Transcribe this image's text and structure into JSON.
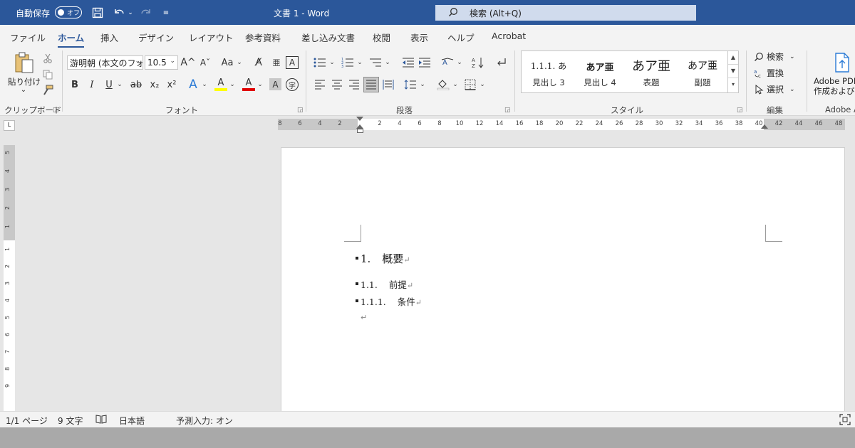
{
  "titlebar": {
    "autosave_label": "自動保存",
    "autosave_state": "オフ",
    "doc_title": "文書 1  -  Word",
    "search_placeholder": "検索 (Alt+Q)",
    "icons": [
      "save-icon",
      "undo-icon",
      "redo-icon",
      "customize-icon",
      "search-icon"
    ]
  },
  "tabs": [
    {
      "label": "ファイル",
      "active": false
    },
    {
      "label": "ホーム",
      "active": true
    },
    {
      "label": "挿入",
      "active": false
    },
    {
      "label": "デザイン",
      "active": false
    },
    {
      "label": "レイアウト",
      "active": false
    },
    {
      "label": "参考資料",
      "active": false
    },
    {
      "label": "差し込み文書",
      "active": false
    },
    {
      "label": "校閲",
      "active": false
    },
    {
      "label": "表示",
      "active": false
    },
    {
      "label": "ヘルプ",
      "active": false
    },
    {
      "label": "Acrobat",
      "active": false
    }
  ],
  "ribbon": {
    "clipboard": {
      "paste_label": "貼り付け",
      "paste_arrow": "⌄",
      "group_label": "クリップボード"
    },
    "font": {
      "font_name": "游明朝 (本文のフォ",
      "font_size": "10.5",
      "group_label": "フォント",
      "bold": "B",
      "italic": "I",
      "underline": "U",
      "strike": "ab",
      "sub": "x₂",
      "sup": "x²",
      "change_case": "Aa",
      "highlight_letter": "A",
      "color_letter": "A",
      "shade_letter": "A",
      "grow": "A^",
      "shrink": "Aˇ",
      "effects_letter": "A",
      "ruby": "亜",
      "border_letter": "A",
      "enclose": "字"
    },
    "paragraph": {
      "group_label": "段落"
    },
    "styles": {
      "group_label": "スタイル",
      "items": [
        {
          "sample": "1.1.1. あ",
          "name": "見出し 3"
        },
        {
          "sample": "あア亜",
          "name": "見出し 4"
        },
        {
          "sample": "あア亜",
          "name": "表題"
        },
        {
          "sample": "あア亜",
          "name": "副題"
        }
      ]
    },
    "editing": {
      "group_label": "編集",
      "find": "検索",
      "replace": "置換",
      "select": "選択"
    },
    "adobe": {
      "line1": "Adobe PDF",
      "line2": "作成および",
      "group_label": "Adobe A"
    }
  },
  "ruler": {
    "h_labels": [
      "8",
      "6",
      "4",
      "2",
      "2",
      "4",
      "6",
      "8",
      "10",
      "12",
      "14",
      "16",
      "18",
      "20",
      "22",
      "24",
      "26",
      "28",
      "30",
      "32",
      "34",
      "36",
      "38",
      "40",
      "42",
      "44",
      "46",
      "48"
    ],
    "v_labels": [
      "5",
      "4",
      "3",
      "2",
      "1",
      "1",
      "2",
      "3",
      "4",
      "5",
      "6",
      "7",
      "8",
      "9"
    ]
  },
  "document": {
    "lines": [
      {
        "number": "1.",
        "text": "概要"
      },
      {
        "number": "1.1.",
        "text": "前提"
      },
      {
        "number": "1.1.1.",
        "text": "条件"
      }
    ],
    "paragraph_mark": "↵"
  },
  "statusbar": {
    "page": "1/1 ページ",
    "words": "9 文字",
    "language": "日本語",
    "predictive": "予測入力: オン"
  },
  "colors": {
    "brand": "#2b579a",
    "ribbon_bg": "#f3f3f3",
    "highlight": "#ffff00",
    "font_color": "#e00000"
  }
}
